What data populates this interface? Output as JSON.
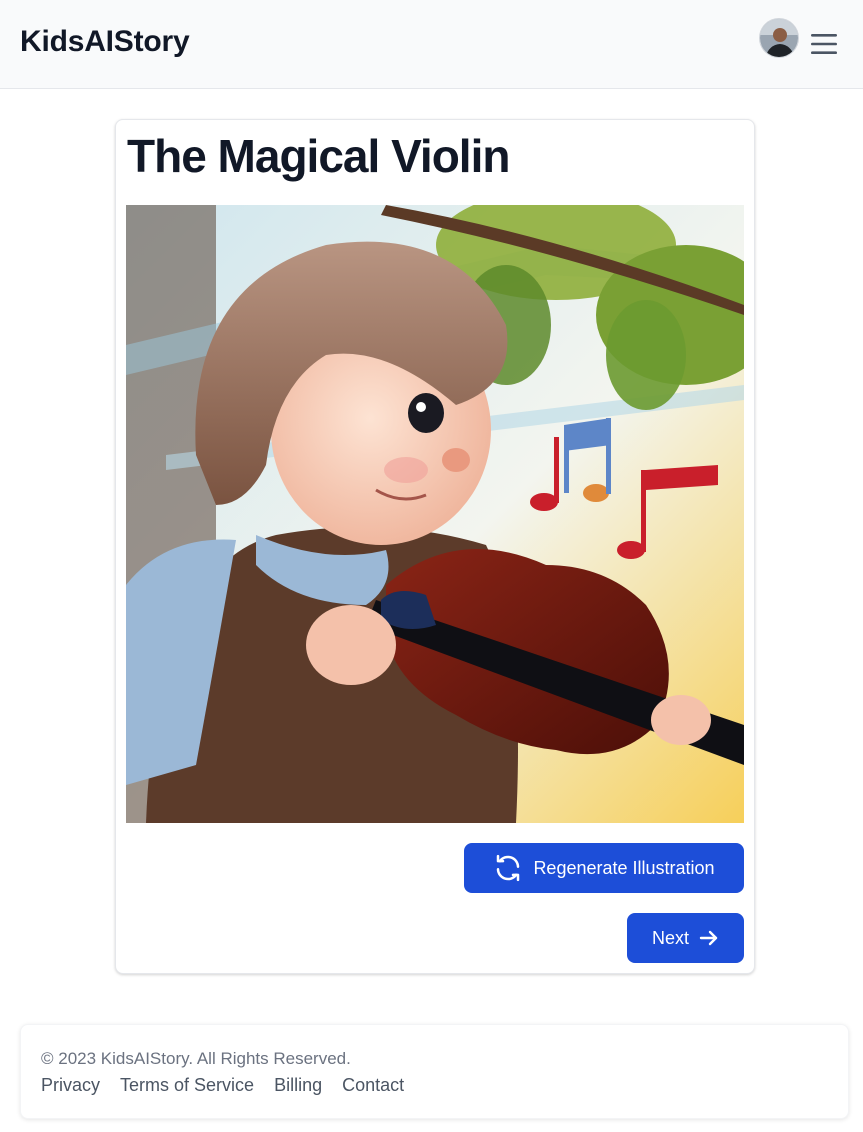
{
  "header": {
    "brand": "KidsAIStory",
    "avatar_icon": "user-avatar",
    "menu_icon": "hamburger-icon"
  },
  "story": {
    "title": "The Magical Violin",
    "illustration_icon": "story-illustration-image"
  },
  "actions": {
    "regenerate_label": "Regenerate Illustration",
    "regenerate_icon": "refresh-icon",
    "next_label": "Next",
    "next_icon": "arrow-right-icon"
  },
  "footer": {
    "copyright": "© 2023 KidsAIStory. All Rights Reserved.",
    "links": [
      "Privacy",
      "Terms of Service",
      "Billing",
      "Contact"
    ]
  },
  "colors": {
    "primary": "#1d4ed8",
    "header_bg": "#f9fafb",
    "text_dark": "#111827",
    "text_muted": "#6b7280"
  }
}
